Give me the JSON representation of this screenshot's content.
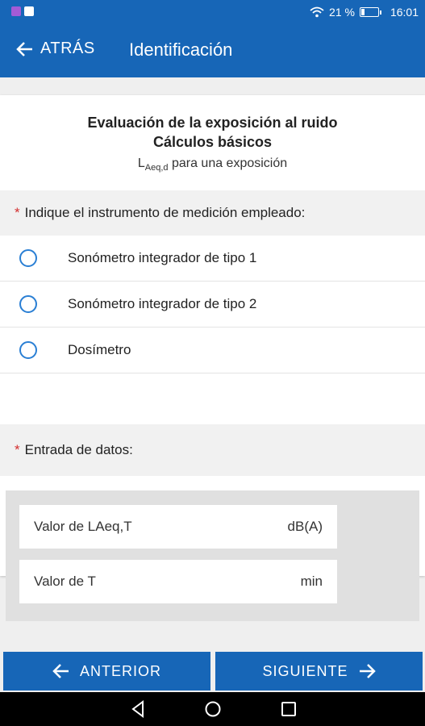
{
  "status_bar": {
    "battery_percent": "21 %",
    "time": "16:01"
  },
  "app_bar": {
    "back_label": "ATRÁS",
    "title": "Identificación"
  },
  "card": {
    "title_line1": "Evaluación de la exposición al ruido",
    "title_line2": "Cálculos básicos",
    "subtitle_L": "L",
    "subtitle_sub": "Aeq,d",
    "subtitle_rest": " para una exposición"
  },
  "instrument_question": {
    "required_mark": "*",
    "label": "Indique el instrumento de medición empleado:",
    "options": [
      {
        "label": "Sonómetro integrador de tipo 1",
        "selected": false
      },
      {
        "label": "Sonómetro integrador de tipo 2",
        "selected": false
      },
      {
        "label": "Dosímetro",
        "selected": false
      }
    ]
  },
  "data_entry": {
    "required_mark": "*",
    "label": "Entrada de datos:",
    "fields": [
      {
        "label": "Valor de LAeq,T",
        "unit": "dB(A)"
      },
      {
        "label": "Valor de T",
        "unit": "min"
      }
    ]
  },
  "navigation": {
    "prev_label": "ANTERIOR",
    "next_label": "SIGUIENTE"
  },
  "colors": {
    "primary": "#1766b7",
    "radio": "#2a7fd4",
    "required": "#d32f2f"
  }
}
